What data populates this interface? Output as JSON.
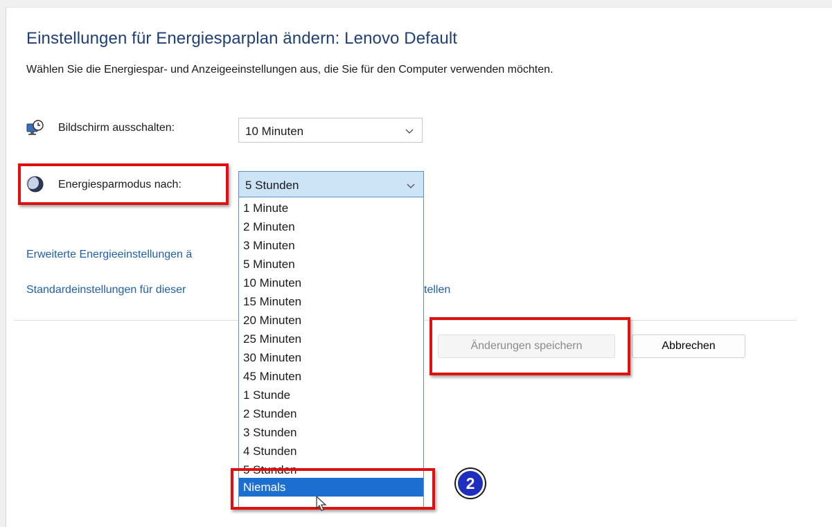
{
  "header": {
    "title": "Einstellungen für Energiesparplan ändern: Lenovo Default",
    "subtitle": "Wählen Sie die Energiespar- und Anzeigeeinstellungen aus, die Sie für den Computer verwenden möchten."
  },
  "display_off": {
    "icon": "monitor-clock-icon",
    "label": "Bildschirm ausschalten:",
    "value": "10 Minuten"
  },
  "sleep": {
    "icon": "moon-icon",
    "label": "Energiesparmodus nach:",
    "value": "5 Stunden",
    "options": [
      "1 Minute",
      "2 Minuten",
      "3 Minuten",
      "5 Minuten",
      "10 Minuten",
      "15 Minuten",
      "20 Minuten",
      "25 Minuten",
      "30 Minuten",
      "45 Minuten",
      "1 Stunde",
      "2 Stunden",
      "3 Stunden",
      "4 Stunden",
      "5 Stunden",
      "Niemals"
    ],
    "highlighted_option": "Niemals"
  },
  "links": {
    "advanced": "Erweiterte Energieeinstellungen ä",
    "restore_start": "Standardeinstellungen für dieser",
    "restore_end": "tellen"
  },
  "buttons": {
    "save": "Änderungen speichern",
    "cancel": "Abbrechen"
  },
  "annotation": {
    "step": "2"
  },
  "colors": {
    "title": "#1e3f78",
    "link": "#1f5fa9",
    "highlight": "#1c6fd1",
    "annotation_red": "#e01010",
    "badge": "#1e2fbf"
  }
}
